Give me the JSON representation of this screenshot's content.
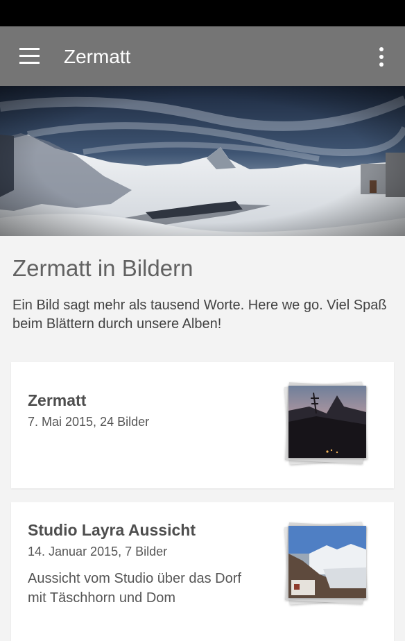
{
  "app_bar": {
    "title": "Zermatt",
    "menu_icon": "hamburger-menu-icon",
    "overflow_icon": "more-vertical-icon"
  },
  "intro": {
    "title": "Zermatt in Bildern",
    "text": "Ein Bild sagt mehr als tausend Worte. Here we go. Viel Spaß beim Blättern durch unsere Alben!"
  },
  "albums": [
    {
      "title": "Zermatt",
      "meta": "7. Mai 2015, 24 Bilder",
      "description": ""
    },
    {
      "title": "Studio Layra Aussicht",
      "meta": "14. Januar 2015, 7 Bilder",
      "description": "Aussicht vom Studio über das Dorf mit Täschhorn und Dom"
    }
  ],
  "colors": {
    "status_bar": "#000000",
    "app_bar": "#757575",
    "background": "#f3f3f3",
    "card": "#ffffff"
  }
}
